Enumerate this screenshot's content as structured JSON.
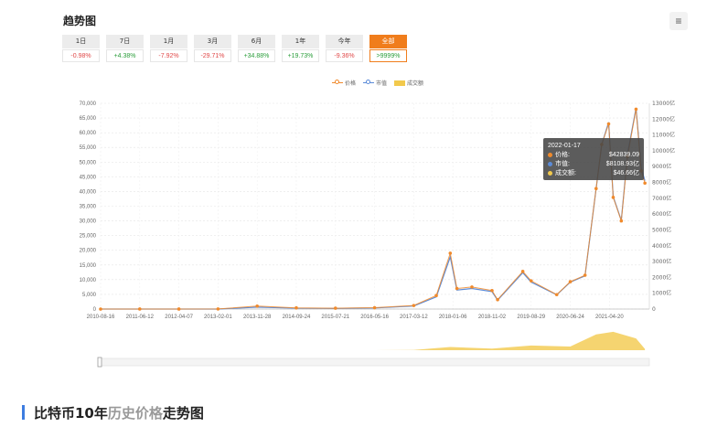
{
  "header": {
    "title": "趋势图",
    "menu_icon": "hamburger-icon"
  },
  "tabs": [
    {
      "label": "1日",
      "change": "-0.98%",
      "trend": "neg"
    },
    {
      "label": "7日",
      "change": "+4.38%",
      "trend": "pos"
    },
    {
      "label": "1月",
      "change": "-7.92%",
      "trend": "neg"
    },
    {
      "label": "3月",
      "change": "-29.71%",
      "trend": "neg"
    },
    {
      "label": "6月",
      "change": "+34.88%",
      "trend": "pos"
    },
    {
      "label": "1年",
      "change": "+19.73%",
      "trend": "pos"
    },
    {
      "label": "今年",
      "change": "-9.36%",
      "trend": "neg"
    },
    {
      "label": "全部",
      "change": ">9999%",
      "trend": "pos",
      "active": true
    }
  ],
  "legend": {
    "price": "价格",
    "market_cap": "市值",
    "volume": "成交额"
  },
  "colors": {
    "price": "#f08a2c",
    "market_cap": "#5b8bd8",
    "volume": "#f2c94c",
    "active_tab": "#f07d1c"
  },
  "tooltip": {
    "date": "2022-01-17",
    "price_label": "价格:",
    "price_value": "$42839.09",
    "mcap_label": "市值:",
    "mcap_value": "$8108.93亿",
    "vol_label": "成交额:",
    "vol_value": "$46.66亿"
  },
  "section": {
    "prefix": "比特币10年",
    "highlight": "历史价格",
    "suffix": "走势图"
  },
  "chart_data": {
    "type": "line",
    "x_ticks": [
      "2010-08-16",
      "2011-06-12",
      "2012-04-07",
      "2013-02-01",
      "2013-11-28",
      "2014-09-24",
      "2015-07-21",
      "2016-05-16",
      "2017-03-12",
      "2018-01-06",
      "2018-11-02",
      "2019-08-29",
      "2020-06-24",
      "2021-04-20"
    ],
    "y_left_ticks": [
      "0",
      "5,000",
      "10,000",
      "15,000",
      "20,000",
      "25,000",
      "30,000",
      "35,000",
      "40,000",
      "45,000",
      "50,000",
      "55,000",
      "60,000",
      "65,000",
      "70,000"
    ],
    "y_right_ticks": [
      "0",
      "1000亿",
      "2000亿",
      "3000亿",
      "4000亿",
      "5000亿",
      "6000亿",
      "7000亿",
      "8000亿",
      "9000亿",
      "10000亿",
      "11000亿",
      "12000亿",
      "13000亿"
    ],
    "ylim_left": [
      0,
      70000
    ],
    "ylim_right": [
      0,
      13000
    ],
    "grid": true,
    "legend_position": "top-center",
    "series": [
      {
        "name": "价格",
        "axis": "left",
        "x": [
          "2010-08-16",
          "2011-06-12",
          "2012-04-07",
          "2013-02-01",
          "2013-11-28",
          "2014-09-24",
          "2015-07-21",
          "2016-05-16",
          "2017-03-12",
          "2017-09-01",
          "2017-12-17",
          "2018-02-06",
          "2018-06-01",
          "2018-11-02",
          "2018-12-15",
          "2019-06-26",
          "2019-08-29",
          "2020-03-12",
          "2020-06-24",
          "2020-10-15",
          "2021-01-08",
          "2021-02-20",
          "2021-04-14",
          "2021-05-19",
          "2021-07-20",
          "2021-09-06",
          "2021-11-10",
          "2021-12-20",
          "2022-01-17"
        ],
        "values": [
          0.07,
          15,
          5,
          20,
          1000,
          400,
          280,
          450,
          1200,
          4600,
          19000,
          7000,
          7500,
          6300,
          3200,
          12800,
          9600,
          4900,
          9300,
          11500,
          41000,
          56000,
          63000,
          38000,
          30000,
          52000,
          68000,
          47000,
          42839
        ]
      },
      {
        "name": "市值",
        "axis": "right",
        "x": [
          "2010-08-16",
          "2011-06-12",
          "2012-04-07",
          "2013-02-01",
          "2013-11-28",
          "2014-09-24",
          "2015-07-21",
          "2016-05-16",
          "2017-03-12",
          "2017-09-01",
          "2017-12-17",
          "2018-02-06",
          "2018-06-01",
          "2018-11-02",
          "2018-12-15",
          "2019-06-26",
          "2019-08-29",
          "2020-03-12",
          "2020-06-24",
          "2020-10-15",
          "2021-01-08",
          "2021-02-20",
          "2021-04-14",
          "2021-05-19",
          "2021-07-20",
          "2021-09-06",
          "2021-11-10",
          "2021-12-20",
          "2022-01-17"
        ],
        "values": [
          0,
          0.5,
          0.5,
          2,
          120,
          55,
          40,
          70,
          190,
          770,
          3300,
          1200,
          1300,
          1100,
          560,
          2300,
          1700,
          900,
          1700,
          2100,
          7600,
          10400,
          11800,
          7100,
          5600,
          9800,
          12700,
          8900,
          8108.93
        ]
      },
      {
        "name": "成交额",
        "axis": "volume",
        "x": [
          "2016-05-16",
          "2017-03-12",
          "2017-12-17",
          "2018-11-02",
          "2019-08-29",
          "2020-06-24",
          "2021-01-08",
          "2021-05-19",
          "2021-11-10",
          "2022-01-17"
        ],
        "values": [
          2,
          10,
          120,
          60,
          180,
          140,
          600,
          700,
          450,
          46.66
        ]
      }
    ]
  }
}
